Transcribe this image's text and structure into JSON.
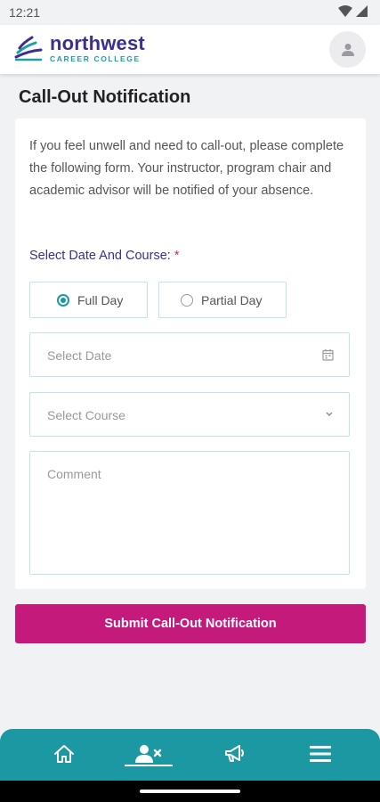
{
  "status_bar": {
    "time": "12:21"
  },
  "header": {
    "logo_name": "northwest",
    "logo_sub": "CAREER COLLEGE"
  },
  "page": {
    "title": "Call-Out Notification"
  },
  "form": {
    "intro": "If you feel unwell and need to call-out, please complete the following form. Your instructor, program chair and academic advisor will be notified of your absence.",
    "section_label": "Select Date And Course:",
    "required_mark": "*",
    "options": [
      {
        "label": "Full Day",
        "selected": true
      },
      {
        "label": "Partial Day",
        "selected": false
      }
    ],
    "date_placeholder": "Select Date",
    "course_placeholder": "Select Course",
    "comment_placeholder": "Comment",
    "submit_label": "Submit Call-Out Notification"
  },
  "nav": {
    "items": [
      {
        "icon": "home-icon"
      },
      {
        "icon": "user-callout-icon",
        "active": true
      },
      {
        "icon": "megaphone-icon"
      },
      {
        "icon": "menu-icon"
      }
    ]
  },
  "colors": {
    "brand_purple": "#3a2f8f",
    "brand_teal": "#1c98a3",
    "submit_magenta": "#c41a7b"
  }
}
